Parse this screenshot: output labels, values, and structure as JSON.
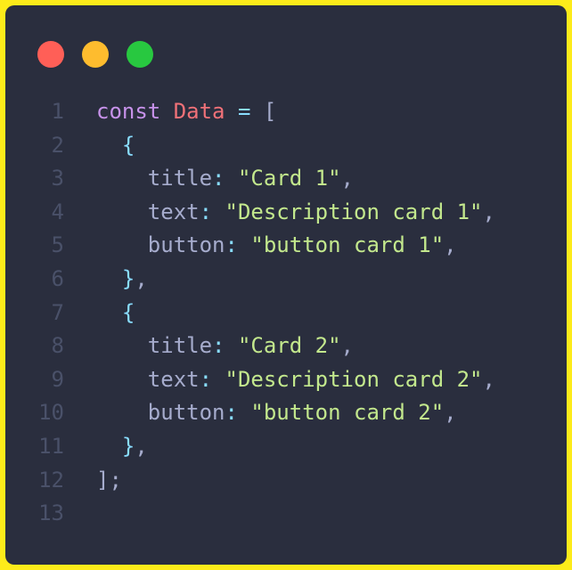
{
  "window": {
    "dots": [
      {
        "name": "close-dot",
        "color": "#ff5f57"
      },
      {
        "name": "minimize-dot",
        "color": "#febc2e"
      },
      {
        "name": "maximize-dot",
        "color": "#28c840"
      }
    ]
  },
  "code": {
    "lines": [
      {
        "num": "1",
        "tokens": [
          {
            "t": "const",
            "c": "kw"
          },
          {
            "t": " ",
            "c": "punc"
          },
          {
            "t": "Data",
            "c": "var"
          },
          {
            "t": " ",
            "c": "punc"
          },
          {
            "t": "=",
            "c": "op"
          },
          {
            "t": " ",
            "c": "punc"
          },
          {
            "t": "[",
            "c": "punc"
          }
        ]
      },
      {
        "num": "2",
        "tokens": [
          {
            "t": "  ",
            "c": "punc"
          },
          {
            "t": "{",
            "c": "brace"
          }
        ]
      },
      {
        "num": "3",
        "tokens": [
          {
            "t": "    ",
            "c": "punc"
          },
          {
            "t": "title",
            "c": "prop"
          },
          {
            "t": ": ",
            "c": "op"
          },
          {
            "t": "\"Card 1\"",
            "c": "str"
          },
          {
            "t": ",",
            "c": "punc"
          }
        ]
      },
      {
        "num": "4",
        "tokens": [
          {
            "t": "    ",
            "c": "punc"
          },
          {
            "t": "text",
            "c": "prop"
          },
          {
            "t": ": ",
            "c": "op"
          },
          {
            "t": "\"Description card 1\"",
            "c": "str"
          },
          {
            "t": ",",
            "c": "punc"
          }
        ]
      },
      {
        "num": "5",
        "tokens": [
          {
            "t": "    ",
            "c": "punc"
          },
          {
            "t": "button",
            "c": "prop"
          },
          {
            "t": ": ",
            "c": "op"
          },
          {
            "t": "\"button card 1\"",
            "c": "str"
          },
          {
            "t": ",",
            "c": "punc"
          }
        ]
      },
      {
        "num": "6",
        "tokens": [
          {
            "t": "  ",
            "c": "punc"
          },
          {
            "t": "}",
            "c": "brace"
          },
          {
            "t": ",",
            "c": "punc"
          }
        ]
      },
      {
        "num": "7",
        "tokens": [
          {
            "t": "  ",
            "c": "punc"
          },
          {
            "t": "{",
            "c": "brace"
          }
        ]
      },
      {
        "num": "8",
        "tokens": [
          {
            "t": "    ",
            "c": "punc"
          },
          {
            "t": "title",
            "c": "prop"
          },
          {
            "t": ": ",
            "c": "op"
          },
          {
            "t": "\"Card 2\"",
            "c": "str"
          },
          {
            "t": ",",
            "c": "punc"
          }
        ]
      },
      {
        "num": "9",
        "tokens": [
          {
            "t": "    ",
            "c": "punc"
          },
          {
            "t": "text",
            "c": "prop"
          },
          {
            "t": ": ",
            "c": "op"
          },
          {
            "t": "\"Description card 2\"",
            "c": "str"
          },
          {
            "t": ",",
            "c": "punc"
          }
        ]
      },
      {
        "num": "10",
        "tokens": [
          {
            "t": "    ",
            "c": "punc"
          },
          {
            "t": "button",
            "c": "prop"
          },
          {
            "t": ": ",
            "c": "op"
          },
          {
            "t": "\"button card 2\"",
            "c": "str"
          },
          {
            "t": ",",
            "c": "punc"
          }
        ]
      },
      {
        "num": "11",
        "tokens": [
          {
            "t": "  ",
            "c": "punc"
          },
          {
            "t": "}",
            "c": "brace"
          },
          {
            "t": ",",
            "c": "punc"
          }
        ]
      },
      {
        "num": "12",
        "tokens": [
          {
            "t": "]",
            "c": "punc"
          },
          {
            "t": ";",
            "c": "punc"
          }
        ]
      },
      {
        "num": "13",
        "tokens": []
      }
    ]
  }
}
